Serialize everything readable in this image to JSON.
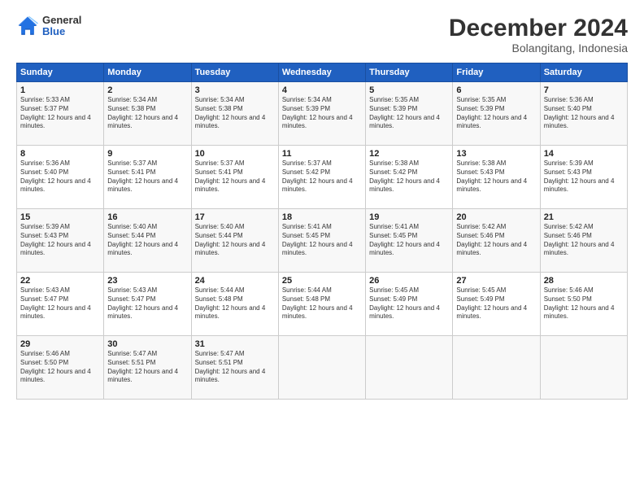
{
  "logo": {
    "general": "General",
    "blue": "Blue"
  },
  "header": {
    "month": "December 2024",
    "location": "Bolangitang, Indonesia"
  },
  "days_of_week": [
    "Sunday",
    "Monday",
    "Tuesday",
    "Wednesday",
    "Thursday",
    "Friday",
    "Saturday"
  ],
  "weeks": [
    [
      {
        "day": "1",
        "text": "Sunrise: 5:33 AM\nSunset: 5:37 PM\nDaylight: 12 hours and 4 minutes."
      },
      {
        "day": "2",
        "text": "Sunrise: 5:34 AM\nSunset: 5:38 PM\nDaylight: 12 hours and 4 minutes."
      },
      {
        "day": "3",
        "text": "Sunrise: 5:34 AM\nSunset: 5:38 PM\nDaylight: 12 hours and 4 minutes."
      },
      {
        "day": "4",
        "text": "Sunrise: 5:34 AM\nSunset: 5:39 PM\nDaylight: 12 hours and 4 minutes."
      },
      {
        "day": "5",
        "text": "Sunrise: 5:35 AM\nSunset: 5:39 PM\nDaylight: 12 hours and 4 minutes."
      },
      {
        "day": "6",
        "text": "Sunrise: 5:35 AM\nSunset: 5:39 PM\nDaylight: 12 hours and 4 minutes."
      },
      {
        "day": "7",
        "text": "Sunrise: 5:36 AM\nSunset: 5:40 PM\nDaylight: 12 hours and 4 minutes."
      }
    ],
    [
      {
        "day": "8",
        "text": "Sunrise: 5:36 AM\nSunset: 5:40 PM\nDaylight: 12 hours and 4 minutes."
      },
      {
        "day": "9",
        "text": "Sunrise: 5:37 AM\nSunset: 5:41 PM\nDaylight: 12 hours and 4 minutes."
      },
      {
        "day": "10",
        "text": "Sunrise: 5:37 AM\nSunset: 5:41 PM\nDaylight: 12 hours and 4 minutes."
      },
      {
        "day": "11",
        "text": "Sunrise: 5:37 AM\nSunset: 5:42 PM\nDaylight: 12 hours and 4 minutes."
      },
      {
        "day": "12",
        "text": "Sunrise: 5:38 AM\nSunset: 5:42 PM\nDaylight: 12 hours and 4 minutes."
      },
      {
        "day": "13",
        "text": "Sunrise: 5:38 AM\nSunset: 5:43 PM\nDaylight: 12 hours and 4 minutes."
      },
      {
        "day": "14",
        "text": "Sunrise: 5:39 AM\nSunset: 5:43 PM\nDaylight: 12 hours and 4 minutes."
      }
    ],
    [
      {
        "day": "15",
        "text": "Sunrise: 5:39 AM\nSunset: 5:43 PM\nDaylight: 12 hours and 4 minutes."
      },
      {
        "day": "16",
        "text": "Sunrise: 5:40 AM\nSunset: 5:44 PM\nDaylight: 12 hours and 4 minutes."
      },
      {
        "day": "17",
        "text": "Sunrise: 5:40 AM\nSunset: 5:44 PM\nDaylight: 12 hours and 4 minutes."
      },
      {
        "day": "18",
        "text": "Sunrise: 5:41 AM\nSunset: 5:45 PM\nDaylight: 12 hours and 4 minutes."
      },
      {
        "day": "19",
        "text": "Sunrise: 5:41 AM\nSunset: 5:45 PM\nDaylight: 12 hours and 4 minutes."
      },
      {
        "day": "20",
        "text": "Sunrise: 5:42 AM\nSunset: 5:46 PM\nDaylight: 12 hours and 4 minutes."
      },
      {
        "day": "21",
        "text": "Sunrise: 5:42 AM\nSunset: 5:46 PM\nDaylight: 12 hours and 4 minutes."
      }
    ],
    [
      {
        "day": "22",
        "text": "Sunrise: 5:43 AM\nSunset: 5:47 PM\nDaylight: 12 hours and 4 minutes."
      },
      {
        "day": "23",
        "text": "Sunrise: 5:43 AM\nSunset: 5:47 PM\nDaylight: 12 hours and 4 minutes."
      },
      {
        "day": "24",
        "text": "Sunrise: 5:44 AM\nSunset: 5:48 PM\nDaylight: 12 hours and 4 minutes."
      },
      {
        "day": "25",
        "text": "Sunrise: 5:44 AM\nSunset: 5:48 PM\nDaylight: 12 hours and 4 minutes."
      },
      {
        "day": "26",
        "text": "Sunrise: 5:45 AM\nSunset: 5:49 PM\nDaylight: 12 hours and 4 minutes."
      },
      {
        "day": "27",
        "text": "Sunrise: 5:45 AM\nSunset: 5:49 PM\nDaylight: 12 hours and 4 minutes."
      },
      {
        "day": "28",
        "text": "Sunrise: 5:46 AM\nSunset: 5:50 PM\nDaylight: 12 hours and 4 minutes."
      }
    ],
    [
      {
        "day": "29",
        "text": "Sunrise: 5:46 AM\nSunset: 5:50 PM\nDaylight: 12 hours and 4 minutes."
      },
      {
        "day": "30",
        "text": "Sunrise: 5:47 AM\nSunset: 5:51 PM\nDaylight: 12 hours and 4 minutes."
      },
      {
        "day": "31",
        "text": "Sunrise: 5:47 AM\nSunset: 5:51 PM\nDaylight: 12 hours and 4 minutes."
      },
      null,
      null,
      null,
      null
    ]
  ]
}
